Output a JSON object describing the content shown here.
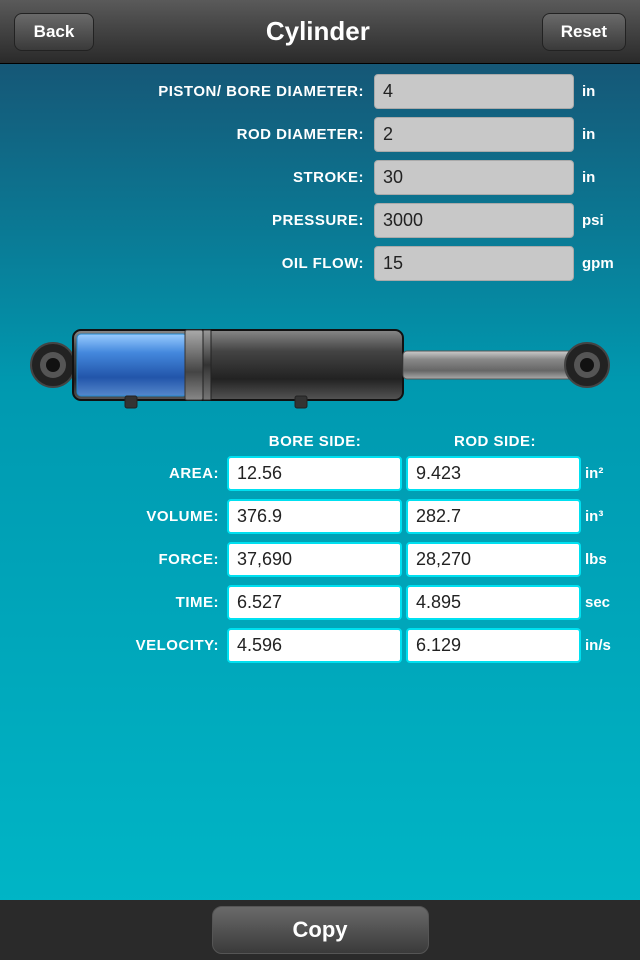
{
  "header": {
    "title": "Cylinder",
    "back_label": "Back",
    "reset_label": "Reset"
  },
  "inputs": [
    {
      "label": "PISTON/ BORE DIAMETER:",
      "value": "4",
      "unit": "in",
      "id": "bore"
    },
    {
      "label": "ROD DIAMETER:",
      "value": "2",
      "unit": "in",
      "id": "rod"
    },
    {
      "label": "STROKE:",
      "value": "30",
      "unit": "in",
      "id": "stroke"
    },
    {
      "label": "PRESSURE:",
      "value": "3000",
      "unit": "psi",
      "id": "pressure"
    },
    {
      "label": "OIL FLOW:",
      "value": "15",
      "unit": "gpm",
      "id": "oilflow"
    }
  ],
  "results": {
    "col1_header": "BORE SIDE:",
    "col2_header": "ROD SIDE:",
    "rows": [
      {
        "label": "AREA:",
        "bore": "12.56",
        "rod": "9.423",
        "unit": "in²"
      },
      {
        "label": "VOLUME:",
        "bore": "376.9",
        "rod": "282.7",
        "unit": "in³"
      },
      {
        "label": "FORCE:",
        "bore": "37,690",
        "rod": "28,270",
        "unit": "lbs"
      },
      {
        "label": "TIME:",
        "bore": "6.527",
        "rod": "4.895",
        "unit": "sec"
      },
      {
        "label": "VELOCITY:",
        "bore": "4.596",
        "rod": "6.129",
        "unit": "in/s"
      }
    ]
  },
  "copy_label": "Copy"
}
